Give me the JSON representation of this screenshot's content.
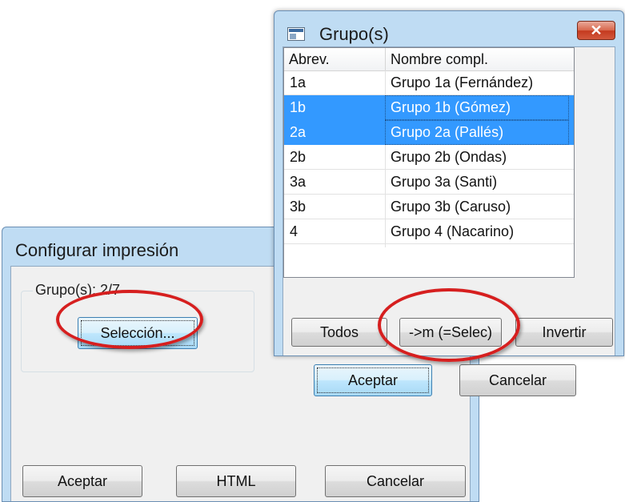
{
  "config_dialog": {
    "title": "Configurar impresión",
    "groups_legend": "Grupo(s): 2/7",
    "selection_button": "Selección...",
    "accept_button": "Aceptar",
    "html_button": "HTML",
    "cancel_button": "Cancelar"
  },
  "groups_dialog": {
    "title": "Grupo(s)",
    "close_glyph": "✕",
    "columns": [
      "Abrev.",
      "Nombre compl."
    ],
    "rows": [
      {
        "abbr": "1a",
        "name": "Grupo 1a (Fernández)",
        "selected": false
      },
      {
        "abbr": "1b",
        "name": "Grupo 1b (Gómez)",
        "selected": true
      },
      {
        "abbr": "2a",
        "name": "Grupo 2a (Pallés)",
        "selected": true
      },
      {
        "abbr": "2b",
        "name": "Grupo 2b (Ondas)",
        "selected": false
      },
      {
        "abbr": "3a",
        "name": "Grupo 3a (Santi)",
        "selected": false
      },
      {
        "abbr": "3b",
        "name": "Grupo 3b (Caruso)",
        "selected": false
      },
      {
        "abbr": "4",
        "name": "Grupo 4 (Nacarino)",
        "selected": false
      }
    ],
    "all_button": "Todos",
    "m_select_button": "->m (=Selec)",
    "invert_button": "Invertir",
    "accept_button": "Aceptar",
    "cancel_button": "Cancelar"
  },
  "colors": {
    "selection": "#3399ff",
    "annotation_ring": "#d61f1f",
    "window_frame": "#bfdcf3"
  }
}
